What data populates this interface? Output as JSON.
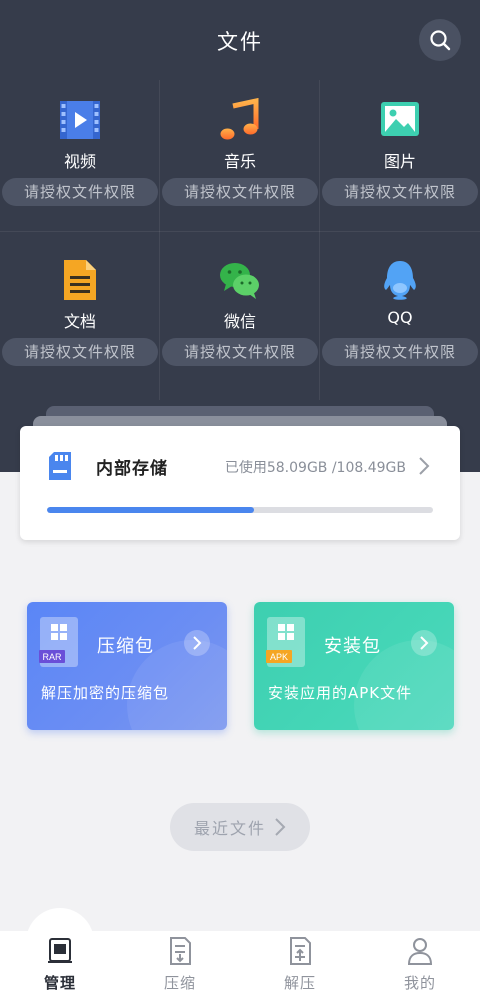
{
  "header": {
    "title": "文件"
  },
  "categories": [
    {
      "label": "视频",
      "icon": "video-icon",
      "permission": "请授权文件权限"
    },
    {
      "label": "音乐",
      "icon": "music-icon",
      "permission": "请授权文件权限"
    },
    {
      "label": "图片",
      "icon": "image-icon",
      "permission": "请授权文件权限"
    },
    {
      "label": "文档",
      "icon": "document-icon",
      "permission": "请授权文件权限"
    },
    {
      "label": "微信",
      "icon": "wechat-icon",
      "permission": "请授权文件权限"
    },
    {
      "label": "QQ",
      "icon": "qq-icon",
      "permission": "请授权文件权限"
    }
  ],
  "storage": {
    "name": "内部存储",
    "used_text": "已使用58.09GB /108.49GB",
    "used_fraction": 0.535
  },
  "cards": [
    {
      "title": "压缩包",
      "badge": "RAR",
      "description": "解压加密的压缩包",
      "color": "#5a86f6"
    },
    {
      "title": "安装包",
      "badge": "APK",
      "description": "安装应用的APK文件",
      "color": "#3dcfb0"
    }
  ],
  "recent": {
    "label": "最近文件"
  },
  "nav": [
    {
      "label": "管理",
      "active": true
    },
    {
      "label": "压缩",
      "active": false
    },
    {
      "label": "解压",
      "active": false
    },
    {
      "label": "我的",
      "active": false
    }
  ],
  "colors": {
    "header_bg": "#363c4b",
    "accent": "#4a86ee"
  }
}
